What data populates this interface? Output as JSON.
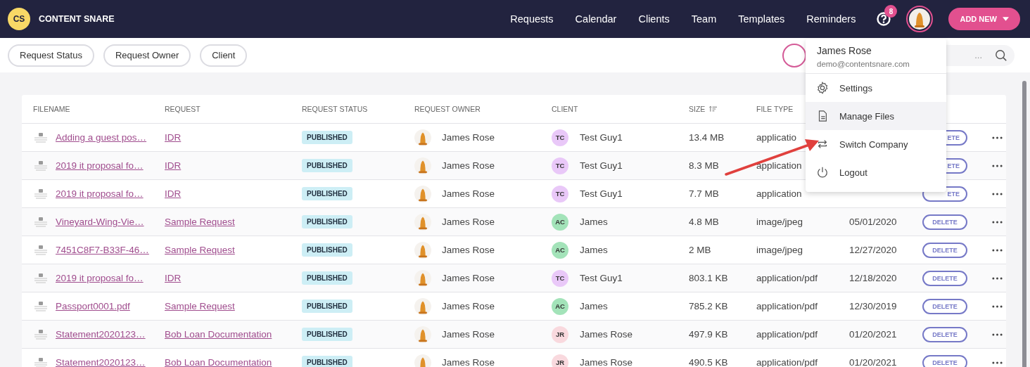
{
  "brand": {
    "initials": "CS",
    "name": "CONTENT SNARE"
  },
  "nav": [
    "Requests",
    "Calendar",
    "Clients",
    "Team",
    "Templates",
    "Reminders"
  ],
  "help_badge": "8",
  "add_button": "ADD NEW",
  "filters": [
    "Request Status",
    "Request Owner",
    "Client"
  ],
  "search": {
    "placeholder": "..."
  },
  "table": {
    "columns": [
      {
        "label": "FILENAME",
        "sorted": false
      },
      {
        "label": "REQUEST",
        "sorted": false
      },
      {
        "label": "REQUEST STATUS",
        "sorted": false
      },
      {
        "label": "REQUEST OWNER",
        "sorted": false
      },
      {
        "label": "CLIENT",
        "sorted": false
      },
      {
        "label": "SIZE",
        "sorted": true
      },
      {
        "label": "FILE TYPE",
        "sorted": false
      }
    ],
    "rows": [
      {
        "filename": "Adding a guest pos…",
        "request": "IDR",
        "status": "PUBLISHED",
        "owner": "James Rose",
        "client": {
          "initials": "TC",
          "name": "Test Guy1",
          "color": "#e9c8f8"
        },
        "size": "13.4 MB",
        "file_type": "applicatio",
        "delete": "ETE",
        "menu_overlap": true
      },
      {
        "filename": "2019 it proposal fo…",
        "request": "IDR",
        "status": "PUBLISHED",
        "owner": "James Rose",
        "client": {
          "initials": "TC",
          "name": "Test Guy1",
          "color": "#e9c8f8"
        },
        "size": "8.3 MB",
        "file_type": "application",
        "delete": "ETE",
        "menu_overlap": true
      },
      {
        "filename": "2019 it proposal fo…",
        "request": "IDR",
        "status": "PUBLISHED",
        "owner": "James Rose",
        "client": {
          "initials": "TC",
          "name": "Test Guy1",
          "color": "#e9c8f8"
        },
        "size": "7.7 MB",
        "file_type": "application",
        "delete": "ETE",
        "menu_overlap": true
      },
      {
        "filename": "Vineyard-Wing-Vie…",
        "request": "Sample Request",
        "status": "PUBLISHED",
        "owner": "James Rose",
        "client": {
          "initials": "AC",
          "name": "James",
          "color": "#a3e3b9"
        },
        "size": "4.8 MB",
        "file_type": "image/jpeg",
        "date": "05/01/2020",
        "delete": "DELETE",
        "menu_overlap": false
      },
      {
        "filename": "7451C8F7-B33F-46…",
        "request": "Sample Request",
        "status": "PUBLISHED",
        "owner": "James Rose",
        "client": {
          "initials": "AC",
          "name": "James",
          "color": "#a3e3b9"
        },
        "size": "2 MB",
        "file_type": "image/jpeg",
        "date": "12/27/2020",
        "delete": "DELETE",
        "menu_overlap": false
      },
      {
        "filename": "2019 it proposal fo…",
        "request": "IDR",
        "status": "PUBLISHED",
        "owner": "James Rose",
        "client": {
          "initials": "TC",
          "name": "Test Guy1",
          "color": "#e9c8f8"
        },
        "size": "803.1 KB",
        "file_type": "application/pdf",
        "date": "12/18/2020",
        "delete": "DELETE",
        "menu_overlap": false
      },
      {
        "filename": "Passport0001.pdf",
        "request": "Sample Request",
        "status": "PUBLISHED",
        "owner": "James Rose",
        "client": {
          "initials": "AC",
          "name": "James",
          "color": "#a3e3b9"
        },
        "size": "785.2 KB",
        "file_type": "application/pdf",
        "date": "12/30/2019",
        "delete": "DELETE",
        "menu_overlap": false
      },
      {
        "filename": "Statement2020123…",
        "request": "Bob Loan Documentation",
        "status": "PUBLISHED",
        "owner": "James Rose",
        "client": {
          "initials": "JR",
          "name": "James Rose",
          "color": "#f9d9de"
        },
        "size": "497.9 KB",
        "file_type": "application/pdf",
        "date": "01/20/2021",
        "delete": "DELETE",
        "menu_overlap": false
      },
      {
        "filename": "Statement2020123…",
        "request": "Bob Loan Documentation",
        "status": "PUBLISHED",
        "owner": "James Rose",
        "client": {
          "initials": "JR",
          "name": "James Rose",
          "color": "#f9d9de"
        },
        "size": "490.5 KB",
        "file_type": "application/pdf",
        "date": "01/20/2021",
        "delete": "DELETE",
        "menu_overlap": false
      }
    ]
  },
  "user_menu": {
    "name": "James Rose",
    "email": "demo@contentsnare.com",
    "items": [
      {
        "kind": "settings",
        "label": "Settings",
        "selected": false
      },
      {
        "kind": "files",
        "label": "Manage Files",
        "selected": true
      },
      {
        "kind": "switch",
        "label": "Switch Company",
        "selected": false
      },
      {
        "kind": "logout",
        "label": "Logout",
        "selected": false
      }
    ]
  }
}
